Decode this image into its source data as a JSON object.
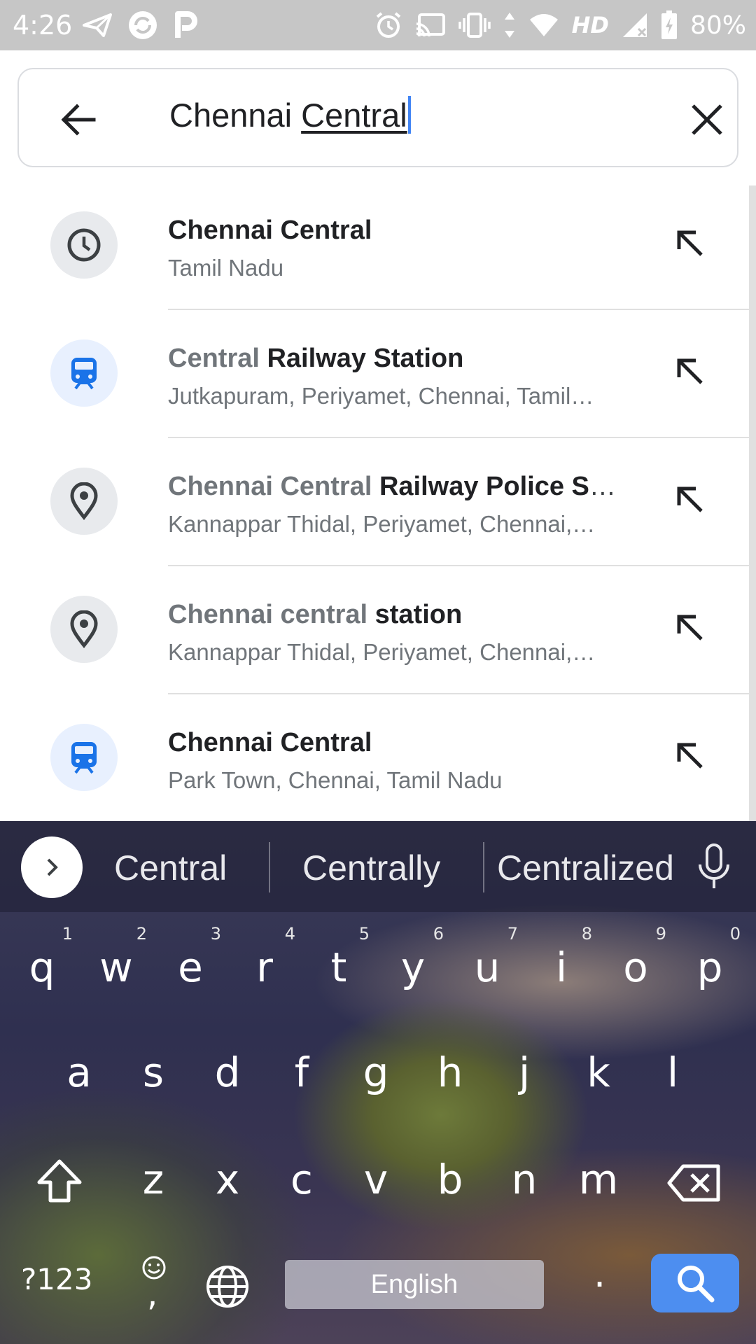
{
  "status_bar": {
    "time": "4:26",
    "hd_label": "HD",
    "battery": "80%"
  },
  "search": {
    "query_prefix": "Chennai ",
    "query_composing": "Central"
  },
  "results": [
    {
      "icon": "clock-icon",
      "icon_style": "grey",
      "title_muted": "",
      "title_strong": "Chennai Central",
      "subtitle": "Tamil Nadu"
    },
    {
      "icon": "train-icon",
      "icon_style": "blue",
      "title_muted": "Central",
      "title_strong": " Railway Station",
      "subtitle": "Jutkapuram, Periyamet, Chennai, Tamil…"
    },
    {
      "icon": "pin-icon",
      "icon_style": "grey",
      "title_muted": "Chennai Central",
      "title_strong": " Railway Police Stati…",
      "subtitle": "Kannappar Thidal, Periyamet, Chennai,…"
    },
    {
      "icon": "pin-icon",
      "icon_style": "grey",
      "title_muted": "Chennai central",
      "title_strong": " station",
      "subtitle": "Kannappar Thidal, Periyamet, Chennai,…"
    },
    {
      "icon": "train-icon",
      "icon_style": "blue",
      "title_muted": "",
      "title_strong": "Chennai Central",
      "subtitle": "Park Town, Chennai, Tamil Nadu"
    }
  ],
  "keyboard": {
    "suggestions": [
      "Central",
      "Centrally",
      "Centralized"
    ],
    "row1": [
      {
        "k": "q",
        "h": "1"
      },
      {
        "k": "w",
        "h": "2"
      },
      {
        "k": "e",
        "h": "3"
      },
      {
        "k": "r",
        "h": "4"
      },
      {
        "k": "t",
        "h": "5"
      },
      {
        "k": "y",
        "h": "6"
      },
      {
        "k": "u",
        "h": "7"
      },
      {
        "k": "i",
        "h": "8"
      },
      {
        "k": "o",
        "h": "9"
      },
      {
        "k": "p",
        "h": "0"
      }
    ],
    "row2": [
      "a",
      "s",
      "d",
      "f",
      "g",
      "h",
      "j",
      "k",
      "l"
    ],
    "row3": [
      "z",
      "x",
      "c",
      "v",
      "b",
      "n",
      "m"
    ],
    "symbols_label": "?123",
    "comma_label": ",",
    "space_label": "English",
    "period_label": "."
  }
}
